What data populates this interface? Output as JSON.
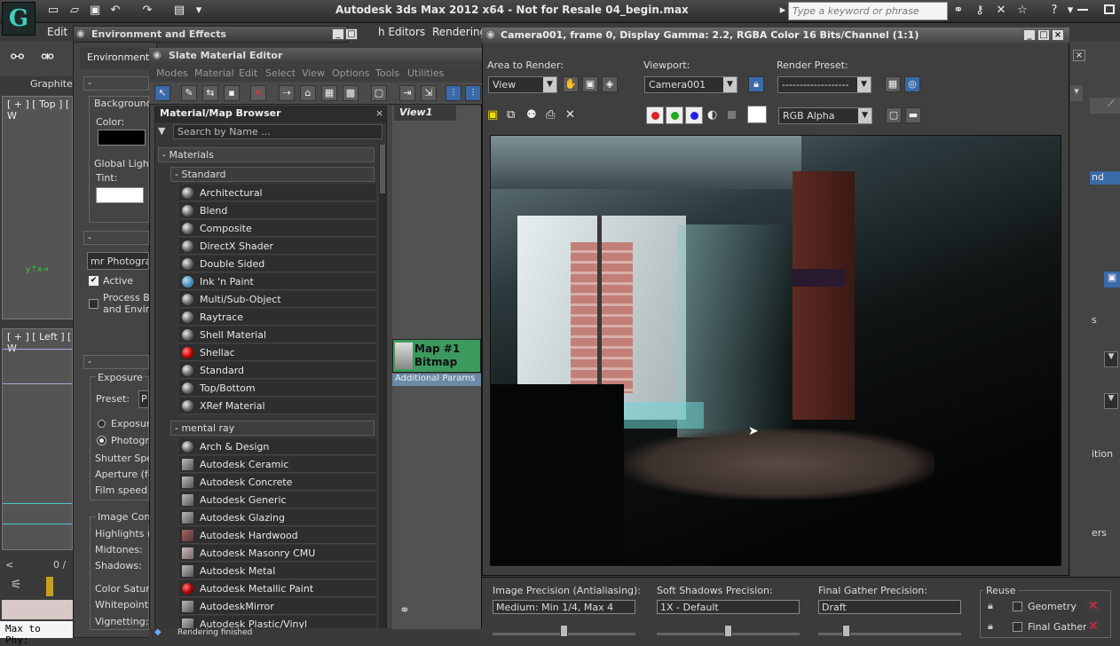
{
  "app": {
    "title": "Autodesk 3ds Max  2012 x64  - Not for Resale   04_begin.max",
    "search_placeholder": "Type a keyword or phrase",
    "menus": [
      "Edit",
      "h Editors",
      "Rendering"
    ]
  },
  "left_viewports": {
    "tab": "Graphite",
    "top_label": "[ + ] [ Top ] [ W",
    "left_label": "[ + ] [ Left ] [ W",
    "frame_counter": "0 /",
    "status_text": "Max to Phy:"
  },
  "env_window": {
    "title": "Environment and Effects",
    "tab": "Environment",
    "background_label": "Background:",
    "color_label": "Color:",
    "global_lighting_label": "Global Lighting",
    "tint_label": "Tint:",
    "exposure_control_value": "mr Photograp",
    "active_label": "Active",
    "process_label": "Process Ba",
    "process_label2": "and Enviro",
    "exposure_label": "Exposure",
    "preset_label": "Preset:",
    "preset_value": "P",
    "exposure_radio": "Exposure",
    "photographic_radio": "Photogra",
    "shutter_label": "Shutter Spee",
    "aperture_label": "Aperture (f-",
    "film_label": "Film speed (",
    "image_control_label": "Image Contr",
    "highlights_label": "Highlights (B",
    "midtones_label": "Midtones:",
    "shadows_label": "Shadows:",
    "color_saturation_label": "Color Satura",
    "whitepoint_label": "Whitepoint:",
    "vignetting_label": "Vignetting:"
  },
  "slate": {
    "title": "Slate Material Editor",
    "menus": [
      "Modes",
      "Material",
      "Edit",
      "Select",
      "View",
      "Options",
      "Tools",
      "Utilities"
    ],
    "browser_title": "Material/Map Browser",
    "search_placeholder": "Search by Name ...",
    "materials_label": "Materials",
    "standard_label": "Standard",
    "standard_items": [
      "Architectural",
      "Blend",
      "Composite",
      "DirectX Shader",
      "Double Sided",
      "Ink 'n Paint",
      "Multi/Sub-Object",
      "Raytrace",
      "Shell Material",
      "Shellac",
      "Standard",
      "Top/Bottom",
      "XRef Material"
    ],
    "mental_ray_label": "mental ray",
    "mental_ray_items": [
      "Arch & Design",
      "Autodesk Ceramic",
      "Autodesk Concrete",
      "Autodesk Generic",
      "Autodesk Glazing",
      "Autodesk Hardwood",
      "Autodesk Masonry CMU",
      "Autodesk Metal",
      "Autodesk Metallic Paint",
      "AutodeskMirror",
      "Autodesk Plastic/Vinyl"
    ],
    "view_tab": "View1",
    "node_title_1": "Map #1",
    "node_title_2": "Bitmap",
    "node_params": "Additional Params",
    "status": "Rendering finished"
  },
  "render_window": {
    "title": "Camera001, frame 0, Display Gamma: 2.2, RGBA Color 16 Bits/Channel (1:1)",
    "area_label": "Area to Render:",
    "area_value": "View",
    "viewport_label": "Viewport:",
    "viewport_value": "Camera001",
    "preset_label": "Render Preset:",
    "preset_value": "-------------------",
    "channel_value": "RGB Alpha"
  },
  "bottom_panel": {
    "image_precision_label": "Image Precision (Antialiasing):",
    "image_precision_value": "Medium: Min 1/4, Max 4",
    "soft_shadows_label": "Soft Shadows Precision:",
    "soft_shadows_value": "1X - Default",
    "final_gather_label": "Final Gather Precision:",
    "final_gather_value": "Draft",
    "reuse_label": "Reuse",
    "geometry_label": "Geometry",
    "final_gather_reuse_label": "Final Gather",
    "image_precision_slider_pct": 50,
    "soft_shadows_slider_pct": 50,
    "final_gather_slider_pct": 20
  },
  "right_panel": {
    "label_s": "s",
    "label_ition": "ition",
    "label_ers": "ers",
    "label_nd": "nd"
  }
}
